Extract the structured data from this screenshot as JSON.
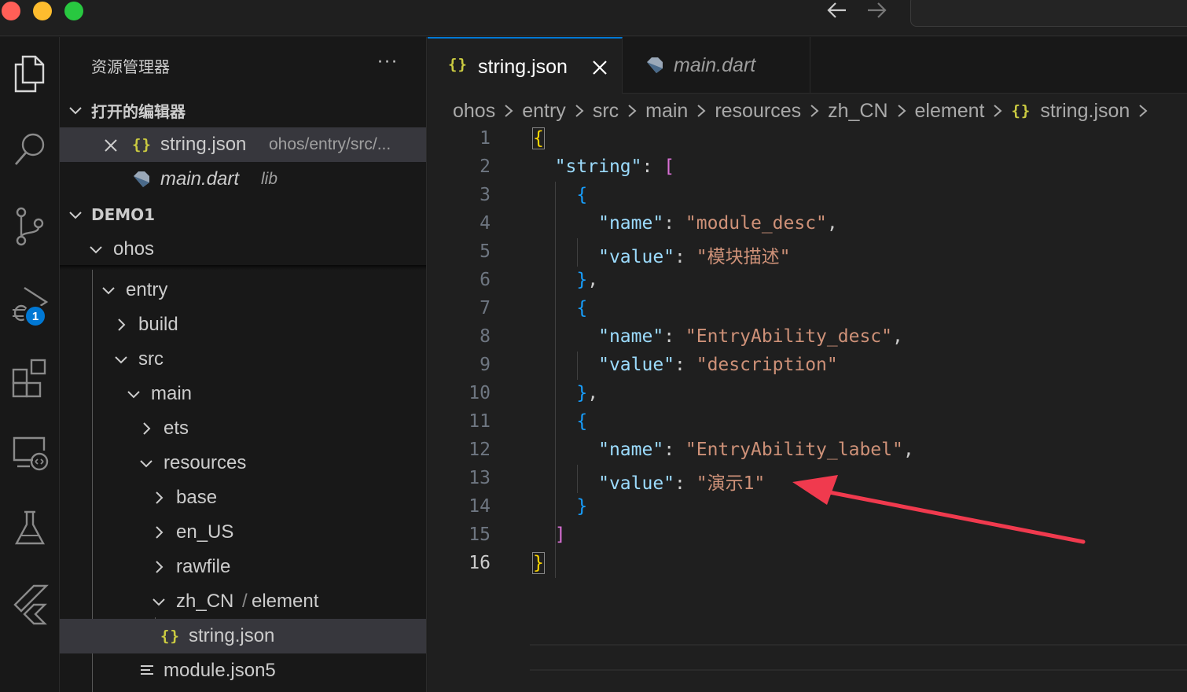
{
  "titlebar": {
    "nav_back_icon": "arrow-left-icon",
    "nav_forward_icon": "arrow-right-icon"
  },
  "activity_bar": {
    "items": [
      "explorer-icon",
      "search-icon",
      "source-control-icon",
      "run-debug-icon",
      "extensions-icon",
      "remote-explorer-icon",
      "testing-icon",
      "flutter-icon"
    ],
    "debug_badge": "1"
  },
  "sidebar": {
    "title": "资源管理器",
    "more": "···",
    "open_editors": {
      "header": "打开的编辑器",
      "items": [
        {
          "icon": "{}",
          "name": "string.json",
          "path": "ohos/entry/src/..."
        },
        {
          "icon": "dart-icon",
          "name": "main.dart",
          "path": "lib"
        }
      ]
    },
    "workspace": {
      "header": "DEMO1",
      "tree": [
        {
          "label": "ohos"
        },
        {
          "label": "entry"
        },
        {
          "label": "build"
        },
        {
          "label": "src"
        },
        {
          "label": "main"
        },
        {
          "label": "ets"
        },
        {
          "label": "resources"
        },
        {
          "label": "base"
        },
        {
          "label": "en_US"
        },
        {
          "label": "rawfile"
        },
        {
          "label": "zh_CN",
          "label2": "element"
        },
        {
          "label": "string.json",
          "icon": "{}"
        },
        {
          "label": "module.json5"
        }
      ]
    }
  },
  "editor": {
    "tabs": [
      {
        "icon": "{}",
        "label": "string.json",
        "active": true
      },
      {
        "icon": "dart-icon",
        "label": "main.dart",
        "active": false
      }
    ],
    "breadcrumb": [
      "ohos",
      "entry",
      "src",
      "main",
      "resources",
      "zh_CN",
      "element",
      "string.json"
    ],
    "breadcrumb_file_icon": "{}",
    "current_line": 16,
    "lines": [
      "{",
      "\"string\": [",
      "{",
      "\"name\": \"module_desc\",",
      "\"value\": \"模块描述\"",
      "},",
      "{",
      "\"name\": \"EntryAbility_desc\",",
      "\"value\": \"description\"",
      "},",
      "{",
      "\"name\": \"EntryAbility_label\",",
      "\"value\": \"演示1\"",
      "}",
      "]",
      "}"
    ],
    "tokens": {
      "string_key": "\"string\"",
      "name_key": "\"name\"",
      "value_key": "\"value\"",
      "v1_name": "\"module_desc\"",
      "v1_value": "\"模块描述\"",
      "v2_name": "\"EntryAbility_desc\"",
      "v2_value": "\"description\"",
      "v3_name": "\"EntryAbility_label\"",
      "v3_value": "\"演示1\""
    },
    "annotation_arrow_color": "#f03a4e"
  },
  "colors": {
    "accent": "#0078d4",
    "json_icon": "#cbcb41",
    "key": "#9cdcfe",
    "string": "#ce9178"
  }
}
